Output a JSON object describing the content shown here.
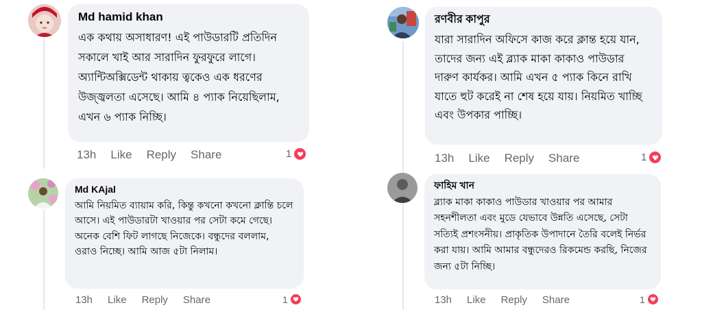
{
  "comments": [
    {
      "author": "Md hamid khan",
      "text": "এক কথায় অসাধারণ! এই পাউডারটি প্রতিদিন সকালে খাই আর সারাদিন ফুরফুরে লাগে। অ্যান্টিঅক্সিডেন্ট থাকায় ত্বকেও এক ধরণের উজ্জ্বলতা এসেছে। আমি ৪ প্যাক নিয়েছিলাম, এখন ৬ প্যাক নিচ্ছি।",
      "time": "13h",
      "like": "Like",
      "reply": "Reply",
      "share": "Share",
      "reactions": "1",
      "reaction_icon": "heart-icon"
    },
    {
      "author": "রণবীর কাপুর",
      "text": "যারা সারাদিন অফিসে কাজ করে ক্লান্ত হয়ে যান, তাদের জন্য এই ব্ল্যাক মাকা কাকাও পাউডার দারুণ কার্যকর। আমি এখন ৫ প্যাক কিনে রাখি যাতে হুট করেই না শেষ হয়ে যায়। নিয়মিত খাচ্ছি এবং উপকার পাচ্ছি।",
      "time": "13h",
      "like": "Like",
      "reply": "Reply",
      "share": "Share",
      "reactions": "1",
      "reaction_icon": "heart-icon"
    },
    {
      "author": "Md KAjal",
      "text": "আমি নিয়মিত ব্যায়াম করি, কিন্তু কখনো কখনো ক্লান্তি চলে আসে। এই পাউডারটা খাওয়ার পর সেটা কমে গেছে। অনেক বেশি ফিট লাগছে নিজেকে। বন্ধুদের বললাম, ওরাও নিচ্ছে। আমি আজ ৫টা নিলাম।",
      "time": "13h",
      "like": "Like",
      "reply": "Reply",
      "share": "Share",
      "reactions": "1",
      "reaction_icon": "heart-icon"
    },
    {
      "author": "ফাহিম খান",
      "text": "ব্ল্যাক মাকা কাকাও পাউডার খাওয়ার পর আমার সহনশীলতা এবং মুডে যেভাবে উন্নতি এসেছে, সেটা সত্যিই প্রশংসনীয়। প্রাকৃতিক উপাদানে তৈরি বলেই নির্ভর করা যায়। আমি আমার বন্ধুদেরও রিকমেন্ড করছি, নিজের জন্য ৫টা নিচ্ছি।",
      "time": "13h",
      "like": "Like",
      "reply": "Reply",
      "share": "Share",
      "reactions": "1",
      "reaction_icon": "heart-icon"
    }
  ],
  "colors": {
    "bubble": "#f0f2f5",
    "action_text": "#65676b",
    "heart": "#f33e58"
  }
}
